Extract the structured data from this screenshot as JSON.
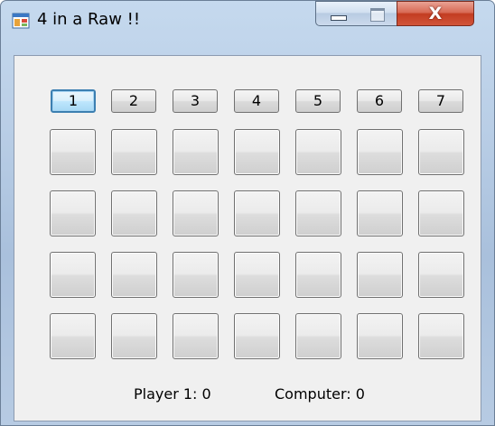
{
  "window": {
    "title": "4 in a Raw !!",
    "icon": "app-window-icon",
    "caption_buttons": [
      "minimize-icon",
      "maximize-icon",
      "close-icon"
    ],
    "close_glyph": "X"
  },
  "columns": [
    "1",
    "2",
    "3",
    "4",
    "5",
    "6",
    "7"
  ],
  "board": {
    "rows": [
      [
        "",
        "",
        "",
        "",
        "",
        "",
        ""
      ],
      [
        "",
        "",
        "",
        "",
        "",
        "",
        ""
      ],
      [
        "",
        "",
        "",
        "",
        "",
        "",
        ""
      ],
      [
        "",
        "",
        "",
        "",
        "",
        "",
        ""
      ]
    ]
  },
  "score": {
    "player": "Player 1: 0",
    "computer": "Computer: 0"
  }
}
